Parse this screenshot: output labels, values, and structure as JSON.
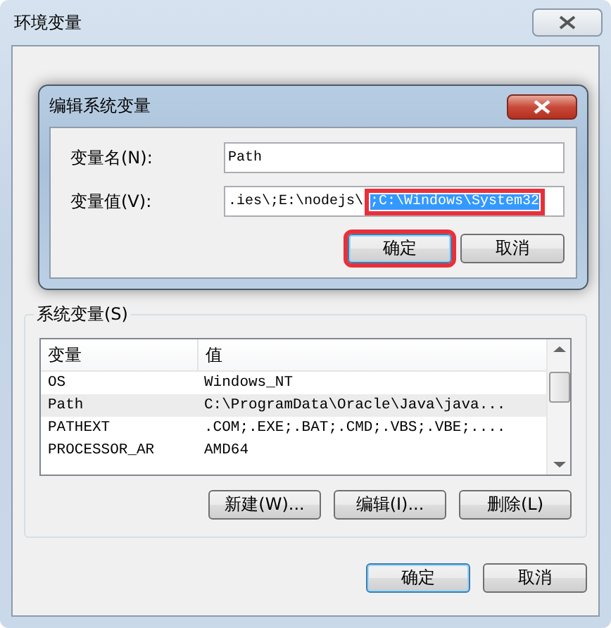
{
  "window": {
    "title": "环境变量"
  },
  "dialog": {
    "title": "编辑系统变量",
    "fields": [
      {
        "label": "变量名(N):",
        "value": "Path"
      },
      {
        "label": "变量值(V):",
        "value": ".ies\\;E:\\nodejs\\",
        "selected_text": ";C:\\Windows\\System32",
        "annotated": true
      }
    ],
    "buttons": [
      {
        "label": "确定",
        "default": true,
        "annotated": true
      },
      {
        "label": "取消",
        "default": false,
        "annotated": false
      }
    ]
  },
  "system_variables": {
    "label": "系统变量(S)",
    "columns": [
      "变量",
      "值"
    ],
    "rows": [
      {
        "cells": [
          "OS",
          "Windows_NT"
        ],
        "selected": false
      },
      {
        "cells": [
          "Path",
          "C:\\ProgramData\\Oracle\\Java\\java..."
        ],
        "selected": true
      },
      {
        "cells": [
          "PATHEXT",
          ".COM;.EXE;.BAT;.CMD;.VBS;.VBE;...."
        ],
        "selected": false
      },
      {
        "cells": [
          "PROCESSOR_AR",
          "AMD64"
        ],
        "selected": false
      }
    ],
    "buttons": [
      "新建(W)...",
      "编辑(I)...",
      "删除(L)"
    ]
  },
  "buttons": [
    {
      "label": "确定",
      "default": true
    },
    {
      "label": "取消",
      "default": false
    }
  ]
}
